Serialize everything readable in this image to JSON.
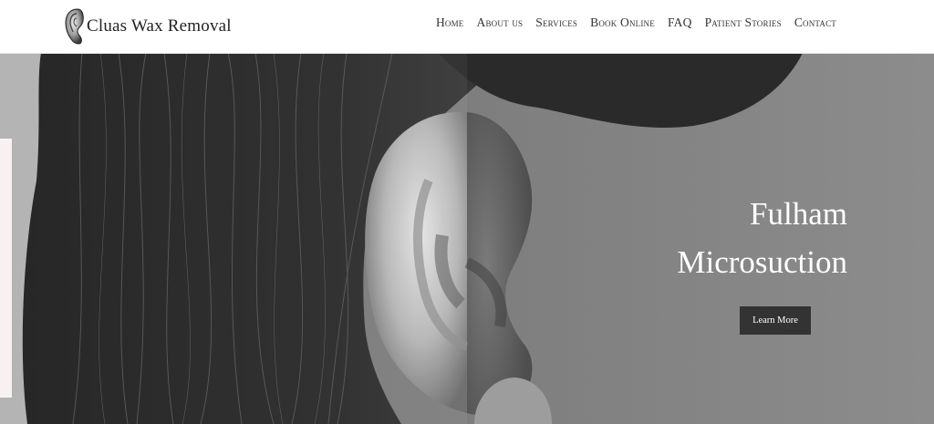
{
  "header": {
    "logo": {
      "text": "Cluas Wax Removal",
      "icon": "ear-icon"
    },
    "nav": [
      {
        "label": "Home"
      },
      {
        "label": "About us"
      },
      {
        "label": "Services"
      },
      {
        "label": "Book Online"
      },
      {
        "label": "FAQ"
      },
      {
        "label": "Patient Stories"
      },
      {
        "label": "Contact"
      }
    ]
  },
  "hero": {
    "title_line1": "Fulham",
    "title_line2": "Microsuction",
    "cta_label": "Learn More",
    "image": "grayscale close-up photo"
  },
  "colors": {
    "header_bg": "#ffffff",
    "nav_text": "#333333",
    "cta_bg": "#333333",
    "cta_text": "#ffffff",
    "hero_title": "#ffffff"
  }
}
